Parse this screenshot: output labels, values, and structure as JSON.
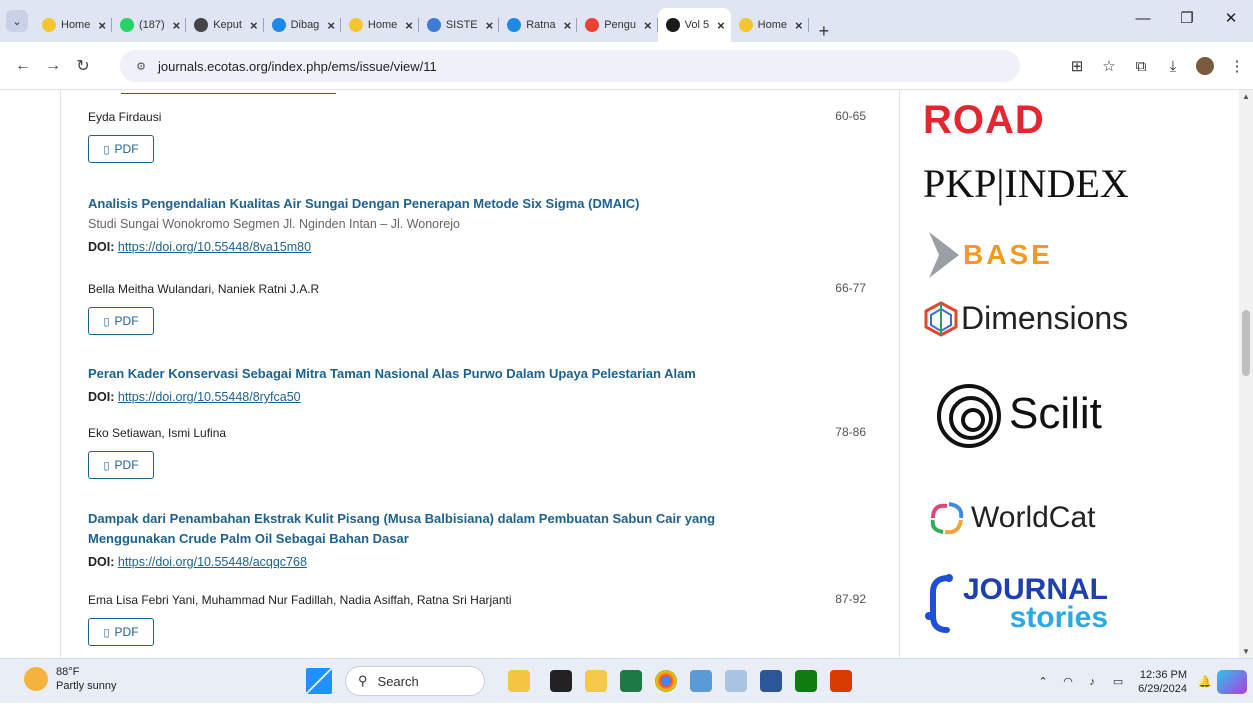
{
  "browser": {
    "tabs": [
      {
        "label": "Home",
        "color": "#f5c531",
        "active": false
      },
      {
        "label": "(187)",
        "color": "#25d366",
        "active": false
      },
      {
        "label": "Keput",
        "color": "#444444",
        "active": false
      },
      {
        "label": "Dibag",
        "color": "#1e88e5",
        "active": false
      },
      {
        "label": "Home",
        "color": "#f5c531",
        "active": false
      },
      {
        "label": "SISTE",
        "color": "#3e7bd6",
        "active": false
      },
      {
        "label": "Ratna",
        "color": "#1e88e5",
        "active": false
      },
      {
        "label": "Pengu",
        "color": "#ea4335",
        "active": false
      },
      {
        "label": "Vol 5",
        "color": "#1b1b1b",
        "active": true
      },
      {
        "label": "Home",
        "color": "#f5c531",
        "active": false
      }
    ],
    "url": "journals.ecotas.org/index.php/ems/issue/view/11"
  },
  "first_article": {
    "authors": "Eyda Firdausi",
    "pages": "60-65",
    "pdf_label": "PDF"
  },
  "articles": [
    {
      "title": "Analisis Pengendalian Kualitas Air Sungai Dengan Penerapan Metode Six Sigma (DMAIC)",
      "subtitle": "Studi Sungai Wonokromo Segmen Jl. Nginden Intan – Jl. Wonorejo",
      "doi_label": "DOI:",
      "doi": "https://doi.org/10.55448/8va15m80",
      "authors": "Bella Meitha Wulandari, Naniek Ratni J.A.R",
      "pages": "66-77",
      "pdf_label": "PDF"
    },
    {
      "title": "Peran Kader Konservasi Sebagai Mitra Taman Nasional Alas Purwo Dalam Upaya Pelestarian Alam",
      "doi_label": "DOI:",
      "doi": "https://doi.org/10.55448/8ryfca50",
      "authors": "Eko Setiawan, Ismi Lufina",
      "pages": "78-86",
      "pdf_label": "PDF"
    },
    {
      "title_line1": "Dampak dari Penambahan Ekstrak Kulit Pisang (Musa Balbisiana) dalam Pembuatan Sabun Cair yang",
      "title_line2": "Menggunakan Crude Palm Oil Sebagai Bahan Dasar",
      "doi_label": "DOI:",
      "doi": "https://doi.org/10.55448/acqqc768",
      "authors": "Ema Lisa Febri Yani, Muhammad Nur Fadillah, Nadia Asiffah, Ratna Sri Harjanti",
      "pages": "87-92",
      "pdf_label": "PDF"
    }
  ],
  "sidebar_logos": {
    "road": "ROAD",
    "pkp": "PKP|INDEX",
    "base": "BASE",
    "dimensions": "Dimensions",
    "scilit": "Scilit",
    "worldcat": "WorldCat",
    "journal_stories_1": "JOURNAL",
    "journal_stories_2": "stories"
  },
  "taskbar": {
    "temp": "88°F",
    "weather": "Partly sunny",
    "search": "Search",
    "time": "12:36 PM",
    "date": "6/29/2024"
  }
}
